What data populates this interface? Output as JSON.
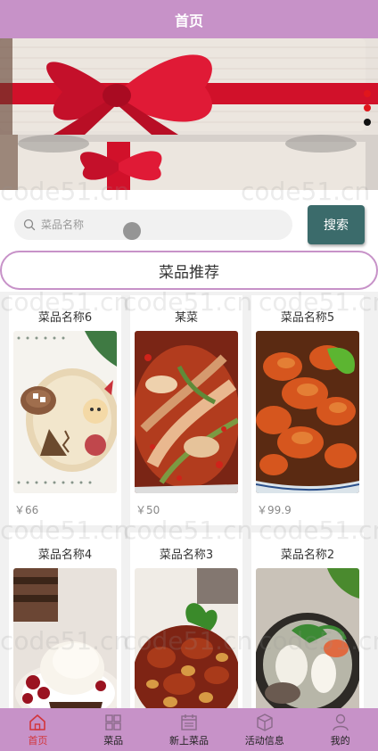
{
  "header": {
    "title": "首页"
  },
  "search": {
    "placeholder": "菜品名称",
    "button_label": "搜索"
  },
  "section": {
    "title": "菜品推荐"
  },
  "watermark": "code51.cn",
  "dishes": [
    {
      "name": "菜品名称6",
      "price": "￥66"
    },
    {
      "name": "某菜",
      "price": "￥50"
    },
    {
      "name": "菜品名称5",
      "price": "￥99.9"
    },
    {
      "name": "菜品名称4",
      "price": ""
    },
    {
      "name": "菜品名称3",
      "price": ""
    },
    {
      "name": "菜品名称2",
      "price": ""
    }
  ],
  "tabbar": {
    "items": [
      {
        "label": "首页",
        "icon": "home-icon",
        "active": true
      },
      {
        "label": "菜品",
        "icon": "grid-icon",
        "active": false
      },
      {
        "label": "新上菜品",
        "icon": "calendar-icon",
        "active": false
      },
      {
        "label": "活动信息",
        "icon": "box-icon",
        "active": false
      },
      {
        "label": "我的",
        "icon": "user-icon",
        "active": false
      }
    ]
  },
  "colors": {
    "brand": "#c792c8",
    "button": "#3b6b6b",
    "active_tab": "#d2353a",
    "banner_dot": "#e0161c"
  }
}
